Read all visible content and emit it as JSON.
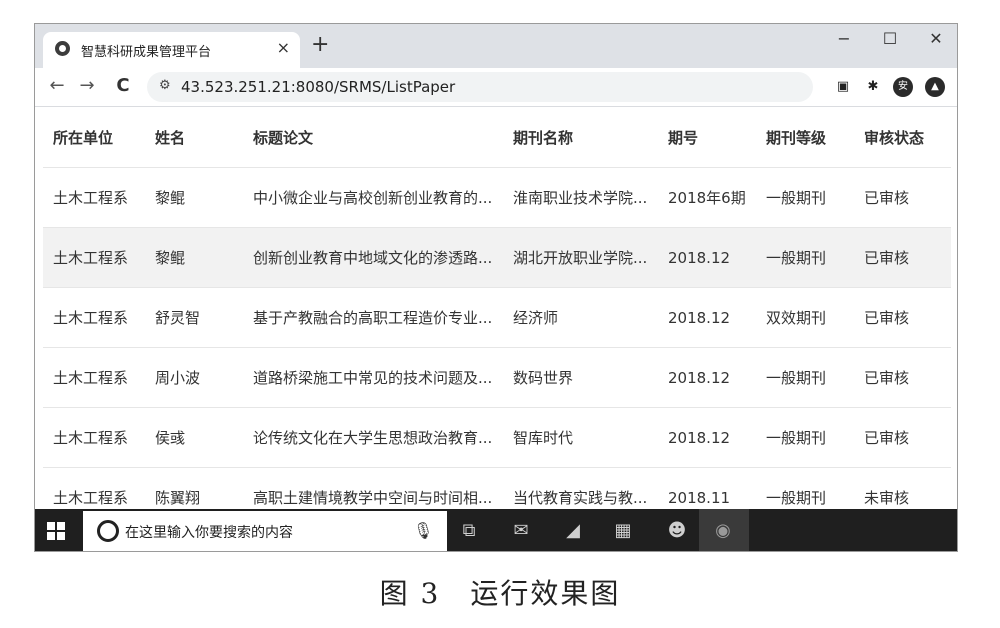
{
  "browser": {
    "tab_title": "智慧科研成果管理平台",
    "tab_close": "×",
    "new_tab": "+",
    "window_controls": {
      "minimize": "−",
      "maximize": "☐",
      "close": "✕"
    },
    "nav": {
      "back": "←",
      "forward": "→",
      "reload": "C"
    },
    "url": "43.523.251.21:8080/SRMS/ListPaper",
    "extensions": {
      "avatar_label": "安"
    }
  },
  "table": {
    "headers": [
      "所在单位",
      "姓名",
      "标题论文",
      "期刊名称",
      "期号",
      "期刊等级",
      "审核状态"
    ],
    "rows": [
      [
        "土木工程系",
        "黎鲲",
        "中小微企业与高校创新创业教育的...",
        "淮南职业技术学院...",
        "2018年6期",
        "一般期刊",
        "已审核"
      ],
      [
        "土木工程系",
        "黎鲲",
        "创新创业教育中地域文化的渗透路...",
        "湖北开放职业学院...",
        "2018.12",
        "一般期刊",
        "已审核"
      ],
      [
        "土木工程系",
        "舒灵智",
        "基于产教融合的高职工程造价专业...",
        "经济师",
        "2018.12",
        "双效期刊",
        "已审核"
      ],
      [
        "土木工程系",
        "周小波",
        "道路桥梁施工中常见的技术问题及...",
        "数码世界",
        "2018.12",
        "一般期刊",
        "已审核"
      ],
      [
        "土木工程系",
        "侯彧",
        "论传统文化在大学生思想政治教育...",
        "智库时代",
        "2018.12",
        "一般期刊",
        "已审核"
      ],
      [
        "土木工程系",
        "陈翼翔",
        "高职土建情境教学中空间与时间相...",
        "当代教育实践与教...",
        "2018.11",
        "一般期刊",
        "未审核"
      ]
    ]
  },
  "taskbar": {
    "search_placeholder": "在这里输入你要搜索的内容"
  },
  "caption": "图 3　运行效果图"
}
